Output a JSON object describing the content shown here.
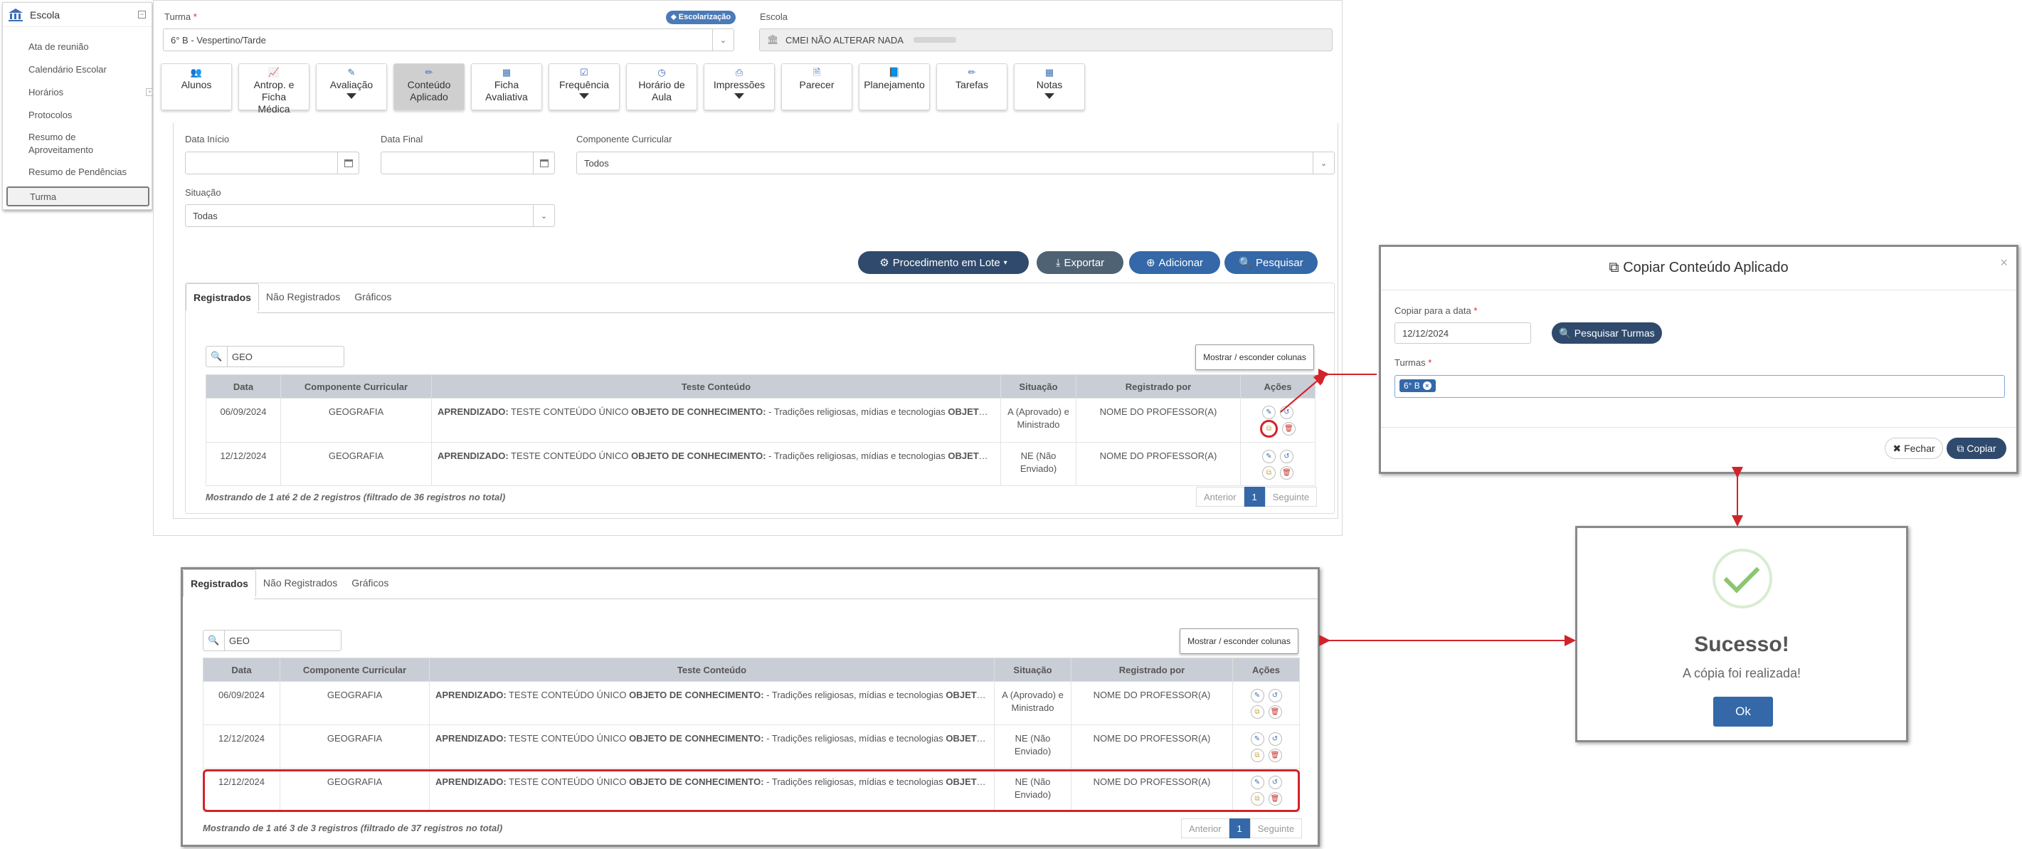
{
  "sidebar": {
    "title": "Escola",
    "items": [
      {
        "label": "Ata de reunião"
      },
      {
        "label": "Calendário Escolar"
      },
      {
        "label": "Horários"
      },
      {
        "label": "Protocolos"
      },
      {
        "label": "Resumo de Aproveitamento"
      },
      {
        "label": "Resumo de Pendências"
      },
      {
        "label": "Turma"
      }
    ]
  },
  "form": {
    "turma_label": "Turma",
    "required_mark": "*",
    "turma_value": "6° B - Vespertino/Tarde",
    "badge": "Escolarização",
    "escola_label": "Escola",
    "escola_value": "CMEI NÃO ALTERAR NADA"
  },
  "tiles": [
    {
      "label": "Alunos",
      "icon": "users-icon"
    },
    {
      "label": "Antrop. e Ficha Médica",
      "icon": "chart-icon"
    },
    {
      "label": "Avaliação",
      "icon": "edit-icon"
    },
    {
      "label": "Conteúdo Aplicado",
      "icon": "pencil-icon"
    },
    {
      "label": "Ficha Avaliativa",
      "icon": "table-icon"
    },
    {
      "label": "Frequência",
      "icon": "check-icon"
    },
    {
      "label": "Horário de Aula",
      "icon": "clock-icon"
    },
    {
      "label": "Impressões",
      "icon": "print-icon"
    },
    {
      "label": "Parecer",
      "icon": "file-icon"
    },
    {
      "label": "Planejamento",
      "icon": "book-icon"
    },
    {
      "label": "Tarefas",
      "icon": "pencil-icon"
    },
    {
      "label": "Notas",
      "icon": "table-icon"
    }
  ],
  "filters": {
    "data_inicio_label": "Data Início",
    "data_final_label": "Data Final",
    "componente_label": "Componente Curricular",
    "componente_value": "Todos",
    "situacao_label": "Situação",
    "situacao_value": "Todas"
  },
  "actions": {
    "lote": "Procedimento em Lote",
    "exportar": "Exportar",
    "adicionar": "Adicionar",
    "pesquisar": "Pesquisar"
  },
  "tabs": [
    "Registrados",
    "Não Registrados",
    "Gráficos"
  ],
  "search_value": "GEO",
  "columns_button": "Mostrar / esconder colunas",
  "table": {
    "headers": [
      "Data",
      "Componente Curricular",
      "Teste Conteúdo",
      "Situação",
      "Registrado por",
      "Ações"
    ],
    "content_prefix1": "APRENDIZADO:",
    "content_mid": " TESTE CONTEÚDO ÚNICO ",
    "content_prefix2": "OBJETO DE CONHECIMENTO:",
    "content_tail": " - Tradições religiosas, mídias e tecnologias ",
    "content_suffix": "OBJETO D...",
    "rows": [
      {
        "date": "06/09/2024",
        "comp": "GEOGRAFIA",
        "sit": "A (Aprovado) e Ministrado",
        "by": "NOME DO PROFESSOR(A)"
      },
      {
        "date": "12/12/2024",
        "comp": "GEOGRAFIA",
        "sit": "NE (Não Enviado)",
        "by": "NOME DO PROFESSOR(A)"
      }
    ],
    "rows_after": [
      {
        "date": "06/09/2024",
        "comp": "GEOGRAFIA",
        "sit": "A (Aprovado) e Ministrado",
        "by": "NOME DO PROFESSOR(A)"
      },
      {
        "date": "12/12/2024",
        "comp": "GEOGRAFIA",
        "sit": "NE (Não Enviado)",
        "by": "NOME DO PROFESSOR(A)"
      },
      {
        "date": "12/12/2024",
        "comp": "GEOGRAFIA",
        "sit": "NE (Não Enviado)",
        "by": "NOME DO PROFESSOR(A)"
      }
    ]
  },
  "showing_before": "Mostrando de 1 até 2 de 2 registros (filtrado de 36 registros no total)",
  "showing_after": "Mostrando de 1 até 3 de 3 registros (filtrado de 37 registros no total)",
  "pager": {
    "prev": "Anterior",
    "page": "1",
    "next": "Seguinte"
  },
  "copy_modal": {
    "title": "Copiar Conteúdo Aplicado",
    "date_label": "Copiar para a data",
    "date_value": "12/12/2024",
    "search_btn": "Pesquisar Turmas",
    "turmas_label": "Turmas",
    "chip": "6° B",
    "close_btn": "Fechar",
    "copy_btn": "Copiar"
  },
  "success_modal": {
    "title": "Sucesso!",
    "text": "A cópia foi realizada!",
    "ok": "Ok"
  },
  "colors": {
    "accent": "#3468a8",
    "highlight": "#d2232a",
    "success": "#8cc56f"
  }
}
